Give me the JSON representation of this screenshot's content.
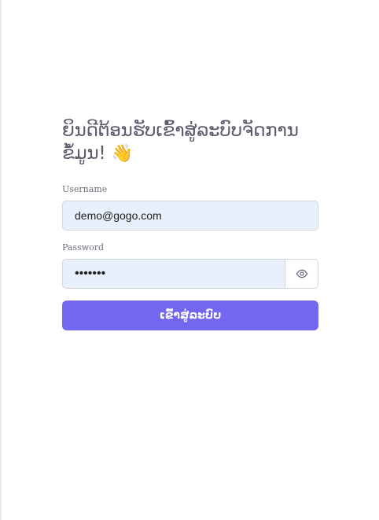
{
  "login": {
    "title": "ຍິນດີຕ້ອນຮັບເຂົ້າສູ່ລະບົບຈັດການຂໍ້ມູນ!",
    "title_emoji": "👋",
    "username_label": "Username",
    "username_value": "demo@gogo.com",
    "password_label": "Password",
    "password_value": "•••••••",
    "submit_label": "ເຂົ້າສູ່ລະບົບ"
  },
  "colors": {
    "primary": "#7367f0",
    "autofill_background": "#e8f0fe",
    "heading_text": "#5d596c",
    "label_text": "#6f6b7d",
    "border": "#d3d5dc"
  },
  "icons": {
    "password_toggle": "eye-icon"
  }
}
